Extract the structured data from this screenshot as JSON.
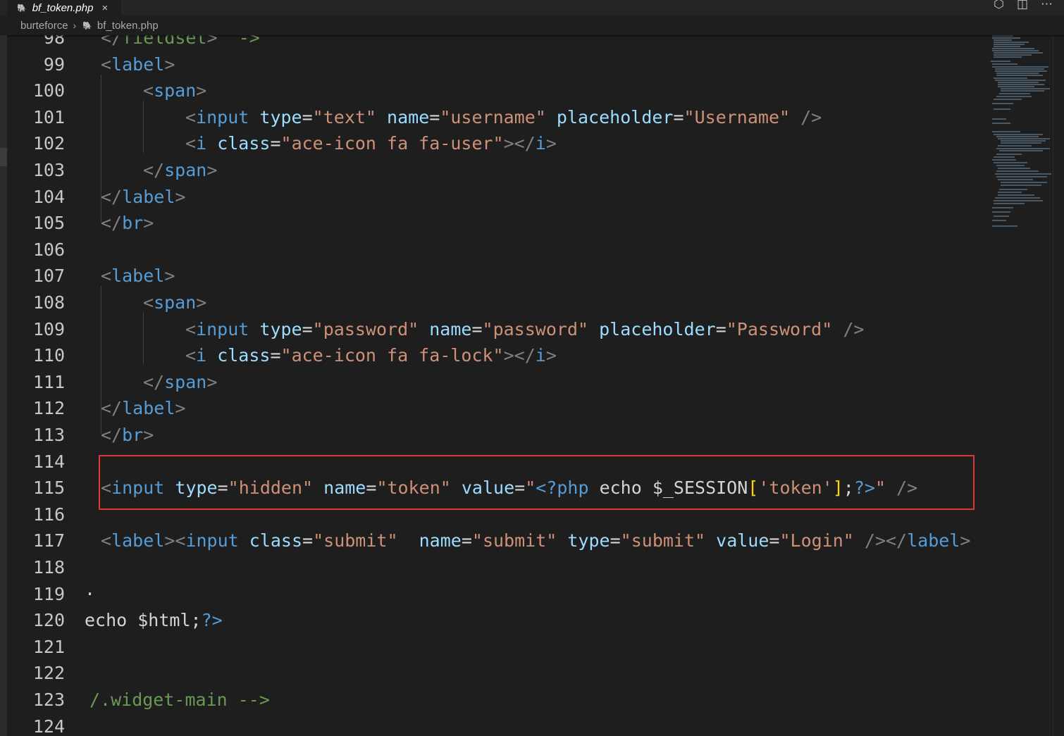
{
  "tab": {
    "filename": "bf_token.php",
    "close_icon": "×"
  },
  "breadcrumb": {
    "folder": "burteforce",
    "separator": "›",
    "file": "bf_token.php"
  },
  "line_numbers": [
    "98",
    "99",
    "100",
    "101",
    "102",
    "103",
    "104",
    "105",
    "106",
    "107",
    "108",
    "109",
    "110",
    "111",
    "112",
    "113",
    "114",
    "115",
    "116",
    "117",
    "118",
    "119",
    "120",
    "121",
    "122",
    "123",
    "124"
  ],
  "code": {
    "l98": [
      [
        "</",
        "t-punct"
      ],
      [
        "fieldset",
        "t-comment"
      ],
      [
        ">",
        "t-punct"
      ],
      [
        "  ->",
        "t-comment"
      ]
    ],
    "l99": [
      [
        "<",
        "t-punct"
      ],
      [
        "label",
        "t-tag"
      ],
      [
        ">",
        "t-punct"
      ]
    ],
    "l100": [
      [
        "<",
        "t-punct"
      ],
      [
        "span",
        "t-tag"
      ],
      [
        ">",
        "t-punct"
      ]
    ],
    "l101": [
      [
        "<",
        "t-punct"
      ],
      [
        "input",
        "t-tag"
      ],
      [
        " ",
        "t-plain"
      ],
      [
        "type",
        "t-attr"
      ],
      [
        "=",
        "t-plain"
      ],
      [
        "\"text\"",
        "t-str"
      ],
      [
        " ",
        "t-plain"
      ],
      [
        "name",
        "t-attr"
      ],
      [
        "=",
        "t-plain"
      ],
      [
        "\"username\"",
        "t-str"
      ],
      [
        " ",
        "t-plain"
      ],
      [
        "placeholder",
        "t-attr"
      ],
      [
        "=",
        "t-plain"
      ],
      [
        "\"Username\"",
        "t-str"
      ],
      [
        " />",
        "t-punct"
      ]
    ],
    "l102": [
      [
        "<",
        "t-punct"
      ],
      [
        "i",
        "t-tag"
      ],
      [
        " ",
        "t-plain"
      ],
      [
        "class",
        "t-attr"
      ],
      [
        "=",
        "t-plain"
      ],
      [
        "\"ace-icon fa fa-user\"",
        "t-str"
      ],
      [
        "></",
        "t-punct"
      ],
      [
        "i",
        "t-tag"
      ],
      [
        ">",
        "t-punct"
      ]
    ],
    "l103": [
      [
        "</",
        "t-punct"
      ],
      [
        "span",
        "t-tag"
      ],
      [
        ">",
        "t-punct"
      ]
    ],
    "l104": [
      [
        "</",
        "t-punct"
      ],
      [
        "label",
        "t-tag"
      ],
      [
        ">",
        "t-punct"
      ]
    ],
    "l105": [
      [
        "</",
        "t-punct"
      ],
      [
        "br",
        "t-tag"
      ],
      [
        ">",
        "t-punct"
      ]
    ],
    "l107": [
      [
        "<",
        "t-punct"
      ],
      [
        "label",
        "t-tag"
      ],
      [
        ">",
        "t-punct"
      ]
    ],
    "l108": [
      [
        "<",
        "t-punct"
      ],
      [
        "span",
        "t-tag"
      ],
      [
        ">",
        "t-punct"
      ]
    ],
    "l109": [
      [
        "<",
        "t-punct"
      ],
      [
        "input",
        "t-tag"
      ],
      [
        " ",
        "t-plain"
      ],
      [
        "type",
        "t-attr"
      ],
      [
        "=",
        "t-plain"
      ],
      [
        "\"password\"",
        "t-str"
      ],
      [
        " ",
        "t-plain"
      ],
      [
        "name",
        "t-attr"
      ],
      [
        "=",
        "t-plain"
      ],
      [
        "\"password\"",
        "t-str"
      ],
      [
        " ",
        "t-plain"
      ],
      [
        "placeholder",
        "t-attr"
      ],
      [
        "=",
        "t-plain"
      ],
      [
        "\"Password\"",
        "t-str"
      ],
      [
        " />",
        "t-punct"
      ]
    ],
    "l110": [
      [
        "<",
        "t-punct"
      ],
      [
        "i",
        "t-tag"
      ],
      [
        " ",
        "t-plain"
      ],
      [
        "class",
        "t-attr"
      ],
      [
        "=",
        "t-plain"
      ],
      [
        "\"ace-icon fa fa-lock\"",
        "t-str"
      ],
      [
        "></",
        "t-punct"
      ],
      [
        "i",
        "t-tag"
      ],
      [
        ">",
        "t-punct"
      ]
    ],
    "l111": [
      [
        "</",
        "t-punct"
      ],
      [
        "span",
        "t-tag"
      ],
      [
        ">",
        "t-punct"
      ]
    ],
    "l112": [
      [
        "</",
        "t-punct"
      ],
      [
        "label",
        "t-tag"
      ],
      [
        ">",
        "t-punct"
      ]
    ],
    "l113": [
      [
        "</",
        "t-punct"
      ],
      [
        "br",
        "t-tag"
      ],
      [
        ">",
        "t-punct"
      ]
    ],
    "l115": [
      [
        "<",
        "t-punct"
      ],
      [
        "input",
        "t-tag"
      ],
      [
        " ",
        "t-plain"
      ],
      [
        "type",
        "t-attr"
      ],
      [
        "=",
        "t-plain"
      ],
      [
        "\"hidden\"",
        "t-str"
      ],
      [
        " ",
        "t-plain"
      ],
      [
        "name",
        "t-attr"
      ],
      [
        "=",
        "t-plain"
      ],
      [
        "\"token\"",
        "t-str"
      ],
      [
        " ",
        "t-plain"
      ],
      [
        "value",
        "t-attr"
      ],
      [
        "=",
        "t-plain"
      ],
      [
        "\"",
        "t-str"
      ],
      [
        "<?php",
        "t-tag"
      ],
      [
        " echo $_SESSION",
        "t-plain"
      ],
      [
        "[",
        "t-bracket"
      ],
      [
        "'token'",
        "t-str"
      ],
      [
        "]",
        "t-bracket"
      ],
      [
        ";",
        "t-plain"
      ],
      [
        "?>",
        "t-tag"
      ],
      [
        "\"",
        "t-str"
      ],
      [
        " />",
        "t-punct"
      ]
    ],
    "l117": [
      [
        "<",
        "t-punct"
      ],
      [
        "label",
        "t-tag"
      ],
      [
        "><",
        "t-punct"
      ],
      [
        "input",
        "t-tag"
      ],
      [
        " ",
        "t-plain"
      ],
      [
        "class",
        "t-attr"
      ],
      [
        "=",
        "t-plain"
      ],
      [
        "\"submit\"",
        "t-str"
      ],
      [
        "  ",
        "t-plain"
      ],
      [
        "name",
        "t-attr"
      ],
      [
        "=",
        "t-plain"
      ],
      [
        "\"submit\"",
        "t-str"
      ],
      [
        " ",
        "t-plain"
      ],
      [
        "type",
        "t-attr"
      ],
      [
        "=",
        "t-plain"
      ],
      [
        "\"submit\"",
        "t-str"
      ],
      [
        " ",
        "t-plain"
      ],
      [
        "value",
        "t-attr"
      ],
      [
        "=",
        "t-plain"
      ],
      [
        "\"Login\"",
        "t-str"
      ],
      [
        " /></",
        "t-punct"
      ],
      [
        "label",
        "t-tag"
      ],
      [
        ">",
        "t-punct"
      ]
    ],
    "l119": [
      [
        "·",
        "t-plain"
      ]
    ],
    "l120": [
      [
        "echo $html;",
        "t-plain"
      ],
      [
        "?>",
        "t-tag"
      ]
    ],
    "l123": [
      [
        "/.widget-main -->",
        "t-comment"
      ]
    ]
  },
  "colors": {
    "background": "#1e1e1e",
    "highlight_box": "#e0363a",
    "tag": "#569cd6",
    "attribute": "#9cdcfe",
    "string": "#ce9178",
    "comment": "#6a9955"
  }
}
